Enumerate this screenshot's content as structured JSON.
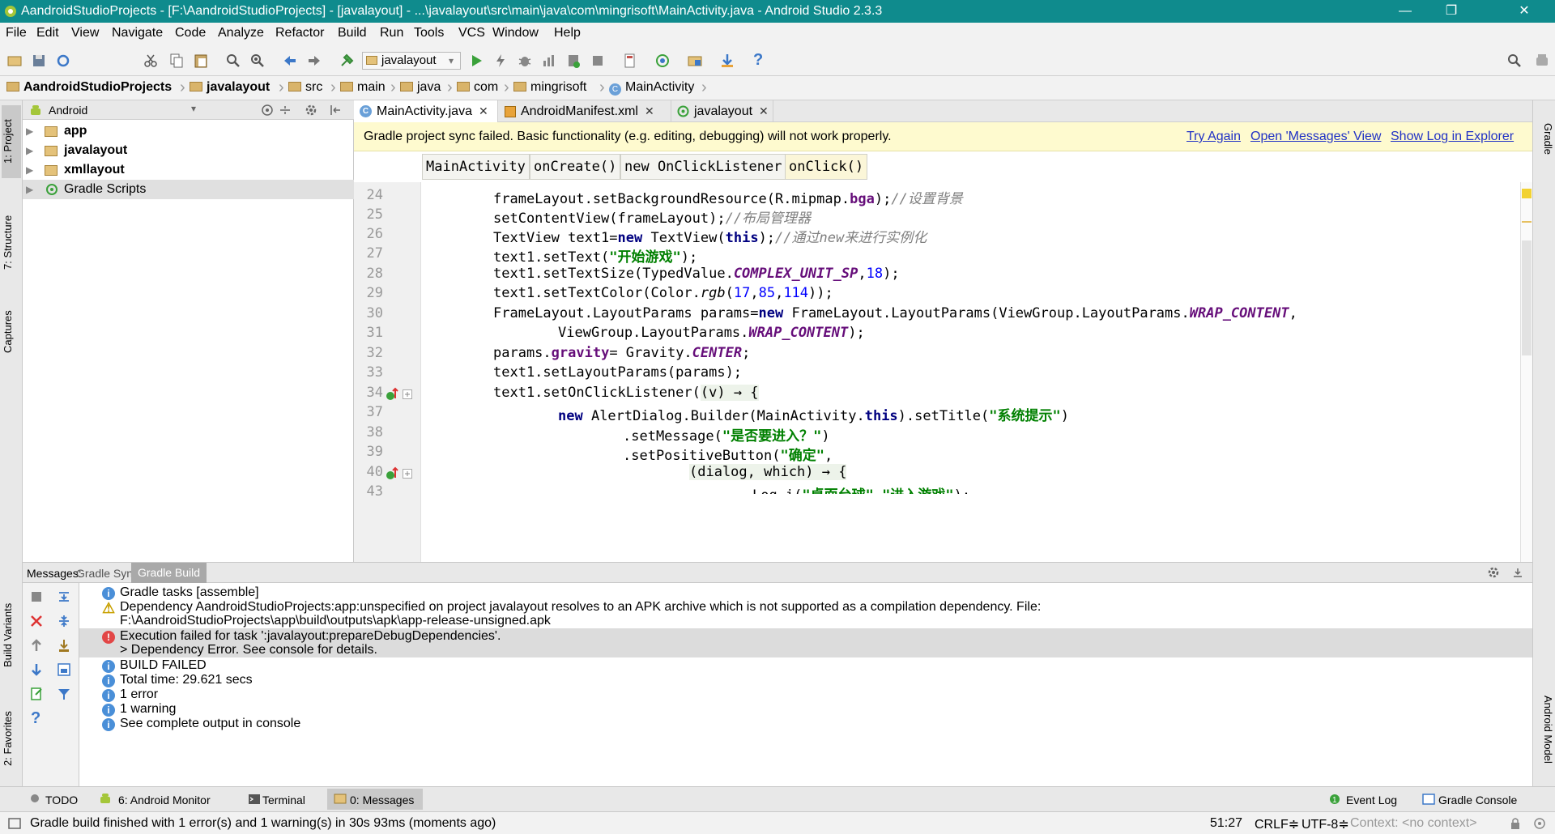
{
  "window": {
    "title": "AandroidStudioProjects - [F:\\AandroidStudioProjects] - [javalayout] - ...\\javalayout\\src\\main\\java\\com\\mingrisoft\\MainActivity.java - Android Studio 2.3.3",
    "minimize": "—",
    "maximize": "❐",
    "close": "✕"
  },
  "menu": [
    "File",
    "Edit",
    "View",
    "Navigate",
    "Code",
    "Analyze",
    "Refactor",
    "Build",
    "Run",
    "Tools",
    "VCS",
    "Window",
    "Help"
  ],
  "toolbar": {
    "run_config": "javalayout",
    "run_config_arrow": "▾",
    "help": "?"
  },
  "breadcrumb": [
    "AandroidStudioProjects",
    "javalayout",
    "src",
    "main",
    "java",
    "com",
    "mingrisoft",
    "MainActivity"
  ],
  "project_panel": {
    "view_mode": "Android",
    "items": [
      {
        "label": "app"
      },
      {
        "label": "javalayout"
      },
      {
        "label": "xmllayout"
      },
      {
        "label": "Gradle Scripts"
      }
    ]
  },
  "left_stripe": [
    "1: Project",
    "7: Structure",
    "Captures",
    "Build Variants",
    "2: Favorites"
  ],
  "right_stripe": [
    "Gradle",
    "Android Model"
  ],
  "editor_tabs": [
    {
      "label": "MainActivity.java",
      "active": true
    },
    {
      "label": "AndroidManifest.xml",
      "active": false
    },
    {
      "label": "javalayout",
      "active": false
    }
  ],
  "banner": {
    "message": "Gradle project sync failed. Basic functionality (e.g. editing, debugging) will not work properly.",
    "try_again": "Try Again",
    "open_messages": "Open 'Messages' View",
    "show_log": "Show Log in Explorer"
  },
  "code_breadcrumbs": [
    "MainActivity",
    "onCreate()",
    "new OnClickListener",
    "onClick()"
  ],
  "line_numbers": [
    "24",
    "25",
    "26",
    "27",
    "28",
    "29",
    "30",
    "31",
    "32",
    "33",
    "34",
    "37",
    "38",
    "39",
    "40",
    "43"
  ],
  "code": {
    "l24a": "frameLayout.setBackgroundResource(R.mipmap.",
    "l24b": "bga",
    "l24c": ");",
    "l24d": "//设置背景",
    "l25a": "setContentView(frameLayout);",
    "l25b": "//布局管理器",
    "l26a": "TextView text1=",
    "l26b": "new",
    "l26c": " TextView(",
    "l26d": "this",
    "l26e": ");",
    "l26f": "//通过new来进行实例化",
    "l27a": "text1.setText(",
    "l27b": "\"开始游戏\"",
    "l27c": ");",
    "l28a": "text1.setTextSize(TypedValue.",
    "l28b": "COMPLEX_UNIT_SP",
    "l28c": ",",
    "l28d": "18",
    "l28e": ");",
    "l29a": "text1.setTextColor(Color.",
    "l29b": "rgb",
    "l29c": "(",
    "l29d": "17",
    "l29e": ",",
    "l29f": "85",
    "l29g": ",",
    "l29h": "114",
    "l29i": "));",
    "l30a": "FrameLayout.LayoutParams params=",
    "l30b": "new",
    "l30c": " FrameLayout.LayoutParams(ViewGroup.LayoutParams.",
    "l30d": "WRAP_CONTENT",
    "l30e": ",",
    "l31a": "ViewGroup.LayoutParams.",
    "l31b": "WRAP_CONTENT",
    "l31c": ");",
    "l32a": "params.",
    "l32b": "gravity",
    "l32c": "= Gravity.",
    "l32d": "CENTER",
    "l32e": ";",
    "l33a": "text1.setLayoutParams(params);",
    "l34a": "text1.setOnClickListener(",
    "l34b": "(v) → {",
    "l37a": "new",
    "l37b": " AlertDialog.Builder(MainActivity.",
    "l37c": "this",
    "l37d": ").setTitle(",
    "l37e": "\"系统提示\"",
    "l37f": ")",
    "l38a": ".setMessage(",
    "l38b": "\"是否要进入？\"",
    "l38c": ")",
    "l39a": ".setPositiveButton(",
    "l39b": "\"确定\"",
    "l39c": ",",
    "l40a": "(dialog, which) → {",
    "l43a": "Log.i(",
    "l43b": "\"桌面台球\"",
    "l43c": ",",
    "l43d": "\"进入游戏\"",
    "l43e": ");"
  },
  "messages_tabs": {
    "label": "Messages:",
    "sync": "Gradle Sync",
    "build": "Gradle Build"
  },
  "messages": [
    {
      "type": "info",
      "text": "Gradle tasks [assemble]"
    },
    {
      "type": "warning",
      "text": "Dependency AandroidStudioProjects:app:unspecified on project javalayout resolves to an APK archive which is not supported as a compilation dependency. File:",
      "text2": "F:\\AandroidStudioProjects\\app\\build\\outputs\\apk\\app-release-unsigned.apk"
    },
    {
      "type": "error",
      "text": "Execution failed for task ':javalayout:prepareDebugDependencies'.",
      "text2": "> Dependency Error. See console for details."
    },
    {
      "type": "info",
      "text": "BUILD FAILED"
    },
    {
      "type": "info",
      "text": "Total time: 29.621 secs"
    },
    {
      "type": "info",
      "text": "1 error"
    },
    {
      "type": "info",
      "text": "1 warning"
    },
    {
      "type": "info",
      "text": "See complete output in console"
    }
  ],
  "bottom_tabs": {
    "todo": "TODO",
    "android_monitor": "6: Android Monitor",
    "terminal": "Terminal",
    "messages": "0: Messages",
    "event_log": "Event Log",
    "gradle_console": "Gradle Console"
  },
  "status": {
    "message": "Gradle build finished with 1 error(s) and 1 warning(s) in 30s 93ms (moments ago)",
    "position": "51:27",
    "line_sep": "CRLF≑",
    "encoding": "UTF-8≑",
    "context": "Context: <no context>"
  },
  "colors": {
    "titlebar": "#0f8b8d",
    "banner_bg": "#fefacf",
    "link": "#2031c5",
    "keyword": "#000080",
    "string": "#008000",
    "comment": "#808080"
  }
}
